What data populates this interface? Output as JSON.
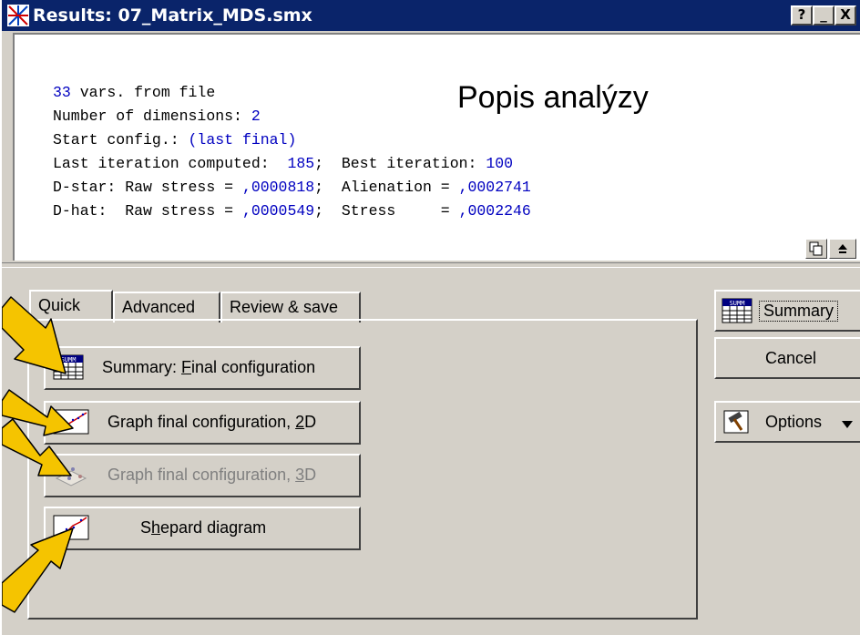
{
  "window": {
    "title": "Results: 07_Matrix_MDS.smx",
    "controls": {
      "help": "?",
      "minimize": "_",
      "close": "X"
    }
  },
  "results_text": {
    "lines": [
      {
        "a": "33",
        "b": " vars. from file"
      },
      {
        "a": "Number of dimensions: ",
        "b": "2"
      },
      {
        "a": "Start config.: ",
        "b": "(last final)"
      },
      {
        "a": "Last iteration computed:  ",
        "b": "185",
        "c": ";  Best iteration: ",
        "d": "100"
      },
      {
        "a": "D-star: Raw stress = ",
        "b": ",0000818",
        "c": ";  Alienation = ",
        "d": ",0002741"
      },
      {
        "a": "D-hat:  Raw stress = ",
        "b": ",0000549",
        "c": ";  Stress     = ",
        "d": ",0002246"
      }
    ]
  },
  "overlay_label": "Popis analýzy",
  "tabs": [
    {
      "label": "Quick"
    },
    {
      "label": "Advanced"
    },
    {
      "label": "Review & save"
    }
  ],
  "quick_buttons": {
    "summary_pre": "Summary: ",
    "summary_ul": "F",
    "summary_post": "inal configuration",
    "graph2d_pre": "Graph final configuration, ",
    "graph2d_ul": "2",
    "graph2d_post": "D",
    "graph3d_pre": "Graph final configuration, ",
    "graph3d_ul": "3",
    "graph3d_post": "D",
    "shepard_pre": "S",
    "shepard_ul": "h",
    "shepard_post": "epard diagram"
  },
  "side_buttons": {
    "summary": "Summary",
    "cancel": "Cancel",
    "options": "Options"
  },
  "icons": {
    "summary": "summary-grid-icon",
    "graph2d": "scatter-2d-icon",
    "graph3d": "scatter-3d-icon",
    "shepard": "shepard-icon",
    "options": "options-hammer-icon"
  },
  "colors": {
    "title_bar": "#0a246a",
    "face": "#d4d0c8",
    "value_blue": "#0000c0",
    "arrow": "#f5c400"
  }
}
